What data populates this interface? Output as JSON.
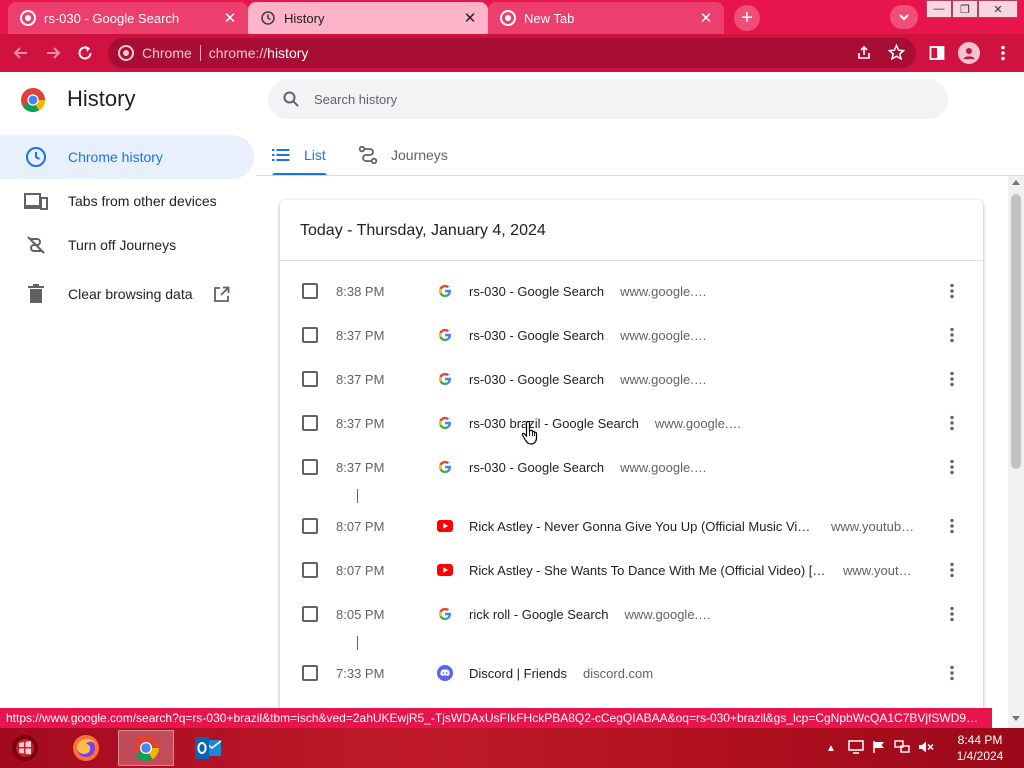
{
  "browser": {
    "tabs": [
      {
        "title": "rs-030 - Google Search",
        "favicon": "chrome-icon",
        "state": "inactive"
      },
      {
        "title": "History",
        "favicon": "history-icon",
        "state": "active"
      },
      {
        "title": "New Tab",
        "favicon": "chrome-icon",
        "state": "inactive"
      }
    ],
    "new_tab_symbol": "+",
    "tab_close_symbol": "✕",
    "window_buttons": {
      "minimize": "—",
      "restore": "❐",
      "close": "✕"
    },
    "omnibox": {
      "site_label": "Chrome",
      "url_prefix": "chrome://",
      "url_host": "history"
    },
    "colors": {
      "frame": "#e8154d",
      "toolbar": "#cf1240",
      "active_tab": "#ffb3c8"
    }
  },
  "page": {
    "title": "History",
    "search": {
      "placeholder": "Search history"
    },
    "sidebar": {
      "items": [
        {
          "label": "Chrome history",
          "icon": "clock-icon",
          "active": true
        },
        {
          "label": "Tabs from other devices",
          "icon": "devices-icon",
          "active": false
        },
        {
          "label": "Turn off Journeys",
          "icon": "journeys-off-icon",
          "active": false
        },
        {
          "label": "Clear browsing data",
          "icon": "trash-icon",
          "active": false
        }
      ]
    },
    "view_tabs": [
      {
        "label": "List",
        "icon": "list-icon",
        "active": true
      },
      {
        "label": "Journeys",
        "icon": "journeys-icon",
        "active": false
      }
    ],
    "day_heading": "Today - Thursday, January 4, 2024",
    "entries": [
      {
        "time": "8:38 PM",
        "title": "rs-030 - Google Search",
        "domain": "www.google.com",
        "icon": "google-icon"
      },
      {
        "time": "8:37 PM",
        "title": "rs-030 - Google Search",
        "domain": "www.google.com",
        "icon": "google-icon"
      },
      {
        "time": "8:37 PM",
        "title": "rs-030 - Google Search",
        "domain": "www.google.com",
        "icon": "google-icon"
      },
      {
        "time": "8:37 PM",
        "title": "rs-030 brazil - Google Search",
        "domain": "www.google.com",
        "icon": "google-icon"
      },
      {
        "time": "8:37 PM",
        "title": "rs-030 - Google Search",
        "domain": "www.google.com",
        "icon": "google-icon"
      },
      {
        "time": "8:07 PM",
        "title": "Rick Astley - Never Gonna Give You Up (Official Music Video)",
        "domain": "www.youtube.com",
        "icon": "youtube-icon"
      },
      {
        "time": "8:07 PM",
        "title": "Rick Astley - She Wants To Dance With Me (Official Video) [Remastered]",
        "domain": "www.youtube.com",
        "icon": "youtube-icon"
      },
      {
        "time": "8:05 PM",
        "title": "rick roll - Google Search",
        "domain": "www.google.com",
        "icon": "google-icon"
      },
      {
        "time": "7:33 PM",
        "title": "Discord | Friends",
        "domain": "discord.com",
        "icon": "discord-icon"
      }
    ],
    "status_url": "https://www.google.com/search?q=rs-030+brazil&tbm=isch&ved=2ahUKEwjR5_-TjsWDAxUsFIkFHckPBA8Q2-cCegQIABAA&oq=rs-030+brazil&gs_lcp=CgNpbWcQA1C7BVjfSWD9S2g..."
  },
  "taskbar": {
    "apps": [
      {
        "name": "firefox-icon",
        "active": false
      },
      {
        "name": "chrome-icon",
        "active": true
      },
      {
        "name": "outlook-icon",
        "active": false
      }
    ],
    "clock": {
      "time": "8:44 PM",
      "date": "1/4/2024"
    }
  }
}
